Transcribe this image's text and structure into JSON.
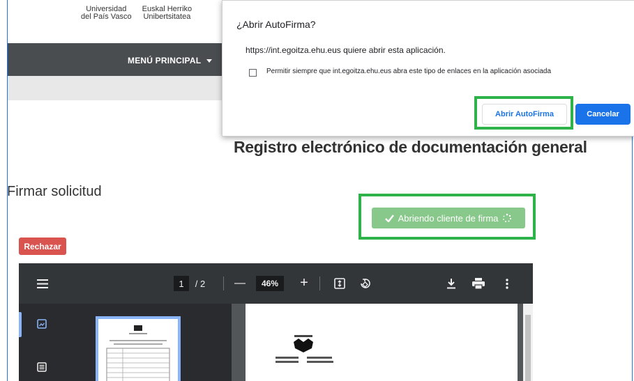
{
  "header": {
    "university_es_line1": "Universidad",
    "university_es_line2": "del País Vasco",
    "university_eu_line1": "Euskal Herriko",
    "university_eu_line2": "Unibertsitatea"
  },
  "navbar": {
    "menu_label": "MENÚ PRINCIPAL"
  },
  "dialog": {
    "title": "¿Abrir AutoFirma?",
    "message": "https://int.egoitza.ehu.eus quiere abrir esta aplicación.",
    "checkbox_label": "Permitir siempre que int.egoitza.ehu.eus abra este tipo de enlaces en la aplicación asociada",
    "checkbox_checked": false,
    "open_button": "Abrir AutoFirma",
    "cancel_button": "Cancelar"
  },
  "main": {
    "page_title": "Registro electrónico de documentación general",
    "section_title": "Firmar solicitud",
    "sign_button": "Abriendo cliente de firma",
    "reject_button": "Rechazar"
  },
  "pdf_viewer": {
    "current_page": "1",
    "page_separator": "/",
    "total_pages": "2",
    "zoom": "46%",
    "minus": "—",
    "plus": "+"
  },
  "colors": {
    "highlight": "#2db34a",
    "primary": "#1a73e8",
    "navbar": "#4a4d50",
    "sign_button": "#88c88a",
    "reject_button": "#d9534f"
  }
}
